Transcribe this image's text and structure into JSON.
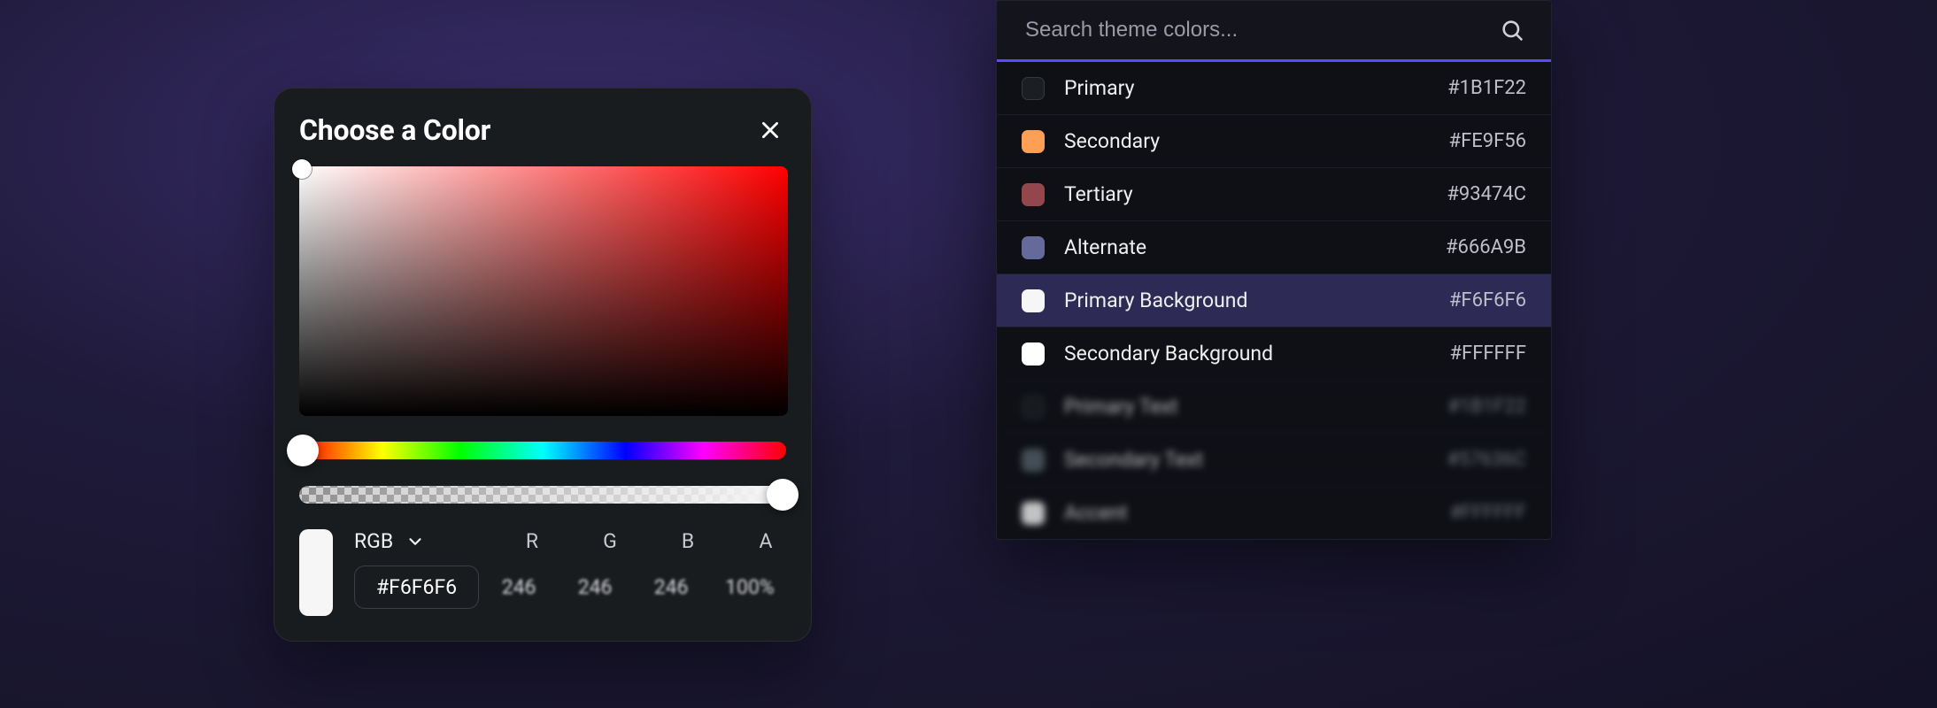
{
  "picker": {
    "title": "Choose a Color",
    "mode": "RGB",
    "hex": "#F6F6F6",
    "channels": {
      "r": "246",
      "g": "246",
      "b": "246",
      "a": "100%"
    },
    "labels": {
      "r": "R",
      "g": "G",
      "b": "B",
      "a": "A"
    },
    "swatch_color": "#F6F6F6",
    "hue_position_pct": 0,
    "alpha_position_pct": 100
  },
  "search": {
    "placeholder": "Search theme colors..."
  },
  "theme_colors": [
    {
      "name": "Primary",
      "hex": "#1B1F22",
      "selected": false,
      "faded": false
    },
    {
      "name": "Secondary",
      "hex": "#FE9F56",
      "selected": false,
      "faded": false
    },
    {
      "name": "Tertiary",
      "hex": "#93474C",
      "selected": false,
      "faded": false
    },
    {
      "name": "Alternate",
      "hex": "#666A9B",
      "selected": false,
      "faded": false
    },
    {
      "name": "Primary Background",
      "hex": "#F6F6F6",
      "selected": true,
      "faded": false
    },
    {
      "name": "Secondary Background",
      "hex": "#FFFFFF",
      "selected": false,
      "faded": false
    },
    {
      "name": "Primary Text",
      "hex": "#1B1F22",
      "selected": false,
      "faded": true
    },
    {
      "name": "Secondary Text",
      "hex": "#57636C",
      "selected": false,
      "faded": true
    },
    {
      "name": "Accent",
      "hex": "#FFFFFF",
      "selected": false,
      "faded": true
    }
  ]
}
